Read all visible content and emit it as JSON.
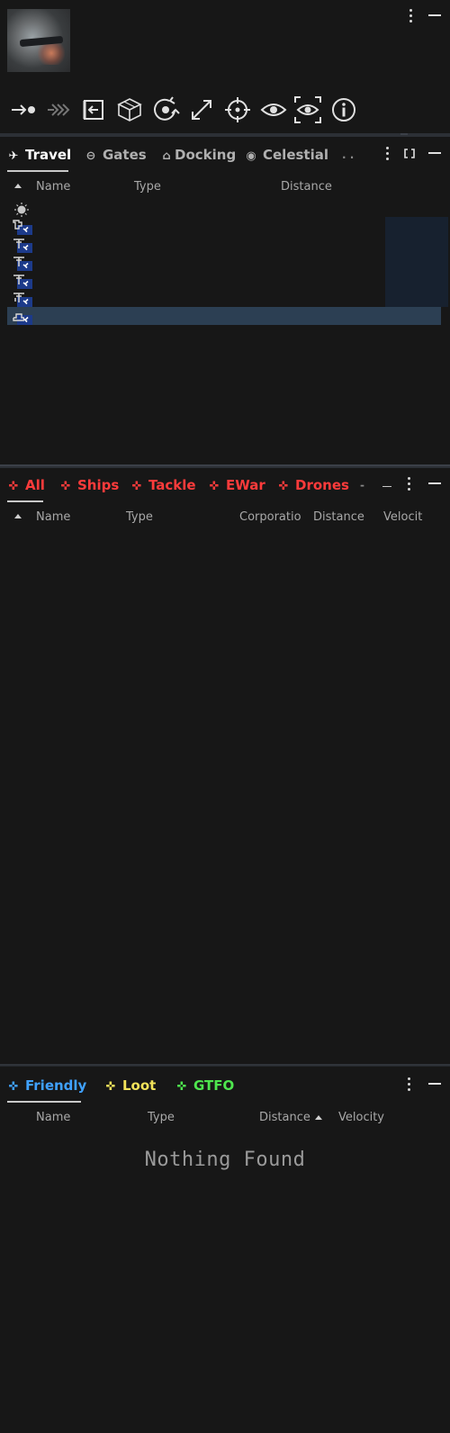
{
  "ship_panel": {
    "actions": [
      {
        "icon": "approach-icon"
      },
      {
        "icon": "warp-icon"
      },
      {
        "icon": "dock-icon"
      },
      {
        "icon": "open-cargo-icon"
      },
      {
        "icon": "orbit-icon"
      },
      {
        "icon": "keep-at-range-icon"
      },
      {
        "icon": "lock-target-icon"
      },
      {
        "icon": "look-at-icon"
      },
      {
        "icon": "set-interest-icon"
      },
      {
        "icon": "show-info-icon"
      }
    ]
  },
  "travel_overview": {
    "tabs": [
      {
        "label": "Travel",
        "icon": "✈",
        "active": true,
        "color": "#ffffff"
      },
      {
        "label": "Gates",
        "icon": "⊖",
        "active": false,
        "color": "#b0b0b0"
      },
      {
        "label": "Docking",
        "icon": "⌂",
        "active": false,
        "color": "#b0b0b0"
      },
      {
        "label": "Celestial",
        "icon": "◉",
        "active": false,
        "color": "#b0b0b0"
      },
      {
        "label": ". .",
        "icon": "",
        "active": false,
        "color": "#888888"
      }
    ],
    "columns": {
      "name": "Name",
      "type": "Type",
      "distance": "Distance"
    },
    "rows": [
      {
        "icon": "sun-icon",
        "selected": false
      },
      {
        "icon": "stargate-icon",
        "selected": false
      },
      {
        "icon": "station-icon",
        "selected": false
      },
      {
        "icon": "station-icon",
        "selected": false
      },
      {
        "icon": "station-icon",
        "selected": false
      },
      {
        "icon": "station-icon",
        "selected": false
      },
      {
        "icon": "stargate-icon",
        "selected": true
      }
    ]
  },
  "ships_overview": {
    "tabs": [
      {
        "label": "All",
        "color": "#ff3b3b",
        "active": true
      },
      {
        "label": "Ships",
        "color": "#ff3b3b",
        "active": false
      },
      {
        "label": "Tackle",
        "color": "#ff3b3b",
        "active": false
      },
      {
        "label": "EWar",
        "color": "#ff3b3b",
        "active": false
      },
      {
        "label": "Drones",
        "color": "#ff3b3b",
        "active": false
      },
      {
        "label": "-",
        "color": "#888888",
        "active": false
      }
    ],
    "columns": {
      "name": "Name",
      "type": "Type",
      "corporation": "Corporatio",
      "distance": "Distance",
      "velocity": "Velocit"
    }
  },
  "friendly_overview": {
    "tabs": [
      {
        "label": "Friendly",
        "color": "#3fa1ff",
        "active": true
      },
      {
        "label": "Loot",
        "color": "#f2e35a",
        "active": false
      },
      {
        "label": "GTFO",
        "color": "#4ee64e",
        "active": false
      }
    ],
    "columns": {
      "name": "Name",
      "type": "Type",
      "distance": "Distance",
      "velocity": "Velocity"
    },
    "empty_message": "Nothing Found"
  }
}
